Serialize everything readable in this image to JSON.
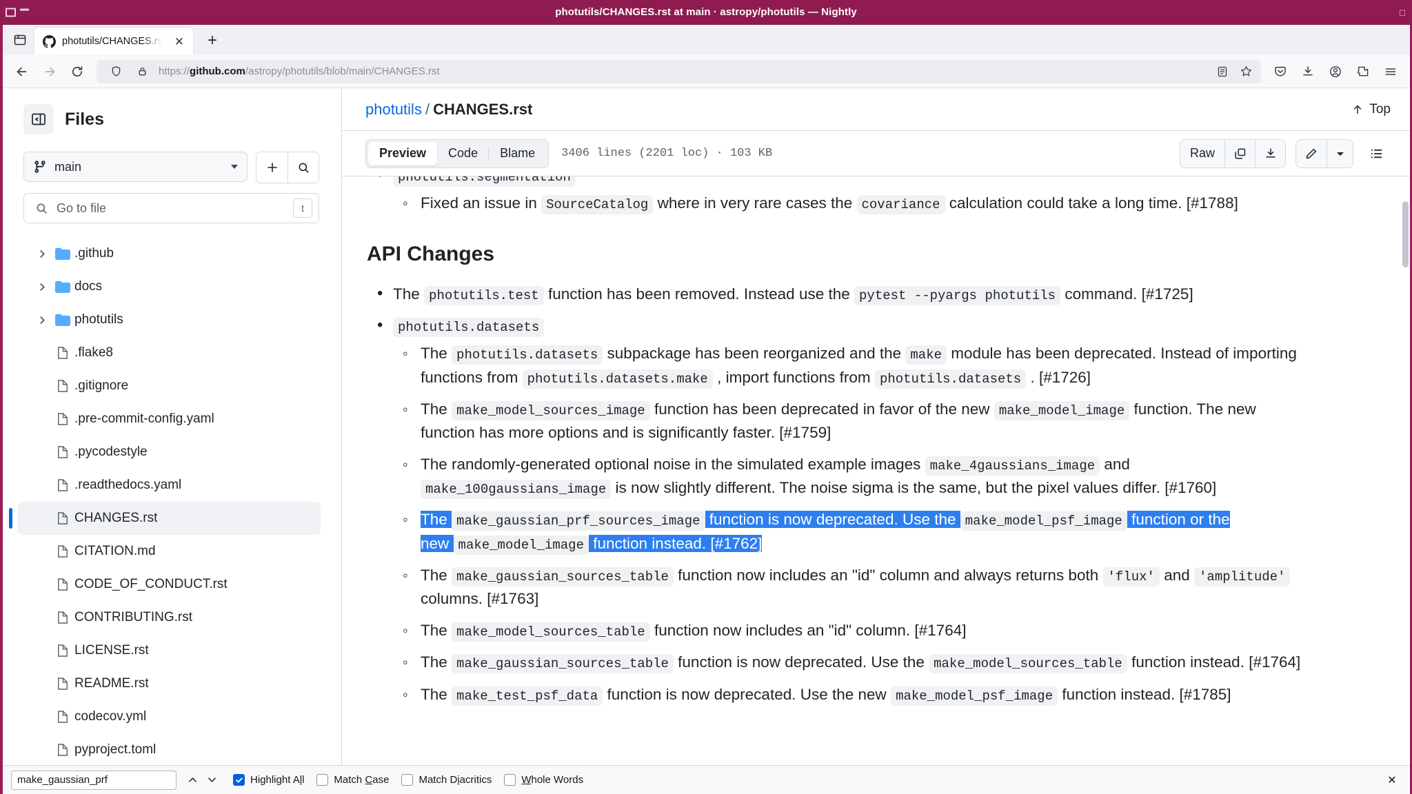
{
  "window": {
    "title": "photutils/CHANGES.rst at main · astropy/photutils — Nightly"
  },
  "browser": {
    "tab": {
      "title": "photutils/CHANGES.rst at",
      "close_label": "✕"
    },
    "newtab_label": "+",
    "url": {
      "prefix": "https://",
      "host": "github.com",
      "path": "/astropy/photutils/blob/main/CHANGES.rst"
    },
    "icons": {
      "back": "back-arrow",
      "forward": "forward-arrow",
      "reload": "reload",
      "shield": "shield",
      "lock": "padlock",
      "reader": "reader-mode",
      "bookmark": "star",
      "pocket": "save-to-pocket",
      "downloads": "downloads",
      "account": "account",
      "extensions": "extensions",
      "menu": "hamburger-menu",
      "list_all_tabs": "list-all-tabs"
    }
  },
  "sidebar": {
    "title": "Files",
    "branch": "main",
    "search_placeholder": "Go to file",
    "search_kbd": "t",
    "add_label": "+",
    "folders": [
      {
        "name": ".github"
      },
      {
        "name": "docs"
      },
      {
        "name": "photutils"
      }
    ],
    "files": [
      {
        "name": ".flake8",
        "active": false
      },
      {
        "name": ".gitignore",
        "active": false
      },
      {
        "name": ".pre-commit-config.yaml",
        "active": false
      },
      {
        "name": ".pycodestyle",
        "active": false
      },
      {
        "name": ".readthedocs.yaml",
        "active": false
      },
      {
        "name": "CHANGES.rst",
        "active": true
      },
      {
        "name": "CITATION.md",
        "active": false
      },
      {
        "name": "CODE_OF_CONDUCT.rst",
        "active": false
      },
      {
        "name": "CONTRIBUTING.rst",
        "active": false
      },
      {
        "name": "LICENSE.rst",
        "active": false
      },
      {
        "name": "README.rst",
        "active": false
      },
      {
        "name": "codecov.yml",
        "active": false
      },
      {
        "name": "pyproject.toml",
        "active": false
      }
    ]
  },
  "content": {
    "breadcrumb": {
      "repo": "photutils",
      "separator": "/",
      "file": "CHANGES.rst"
    },
    "top_button": "Top",
    "tabs": [
      {
        "label": "Preview",
        "active": true
      },
      {
        "label": "Code",
        "active": false
      },
      {
        "label": "Blame",
        "active": false
      }
    ],
    "file_stats": "3406 lines (2201 loc) · 103 KB",
    "actions": {
      "raw": "Raw",
      "copy": "copy-icon",
      "download": "download-icon",
      "edit": "pencil-icon",
      "more": "chevron-down-icon",
      "outline": "outline-icon"
    }
  },
  "document": {
    "partial_top": {
      "module": "photutils.segmentation",
      "item_a": "Fixed an issue in",
      "code_a": "SourceCatalog",
      "item_b": "where in very rare cases the",
      "code_b": "covariance",
      "item_c": "calculation could take a long time.",
      "ref": "[#1788]"
    },
    "heading": "API Changes",
    "b1": {
      "t1": "The",
      "c1": "photutils.test",
      "t2": "function has been removed. Instead use the",
      "c2": "pytest --pyargs photutils",
      "t3": "command. [#1725]"
    },
    "b2": {
      "code": "photutils.datasets",
      "sub1": {
        "t1": "The",
        "c1": "photutils.datasets",
        "t2": "subpackage has been reorganized and the",
        "c2": "make",
        "t3": "module has been deprecated. Instead of importing functions from",
        "c3": "photutils.datasets.make",
        "t4": ", import functions from",
        "c4": "photutils.datasets",
        "t5": ". [#1726]"
      },
      "sub2": {
        "t1": "The",
        "c1": "make_model_sources_image",
        "t2": "function has been deprecated in favor of the new",
        "c2": "make_model_image",
        "t3": "function. The new function has more options and is significantly faster. [#1759]"
      },
      "sub3": {
        "t1": "The randomly-generated optional noise in the simulated example images",
        "c1": "make_4gaussians_image",
        "t2": "and",
        "c2": "make_100gaussians_image",
        "t3": "is now slightly different. The noise sigma is the same, but the pixel values differ. [#1760]"
      },
      "sub4": {
        "highlighted": true,
        "t1": "The",
        "c1": "make_gaussian_prf_sources_image",
        "t2": "function is now deprecated. Use the",
        "c2": "make_model_psf_image",
        "t3": "function or the new",
        "c3": "make_model_image",
        "t4": "function instead. [#1762]"
      },
      "sub5": {
        "t1": "The",
        "c1": "make_gaussian_sources_table",
        "t2": "function now includes an \"id\" column and always returns both",
        "c2": "'flux'",
        "t3": "and",
        "c3": "'amplitude'",
        "t4": "columns. [#1763]"
      },
      "sub6": {
        "t1": "The",
        "c1": "make_model_sources_table",
        "t2": "function now includes an \"id\" column. [#1764]"
      },
      "sub7": {
        "t1": "The",
        "c1": "make_gaussian_sources_table",
        "t2": "function is now deprecated. Use the",
        "c2": "make_model_sources_table",
        "t3": "function instead. [#1764]"
      },
      "sub8": {
        "t1": "The",
        "c1": "make_test_psf_data",
        "t2": "function is now deprecated. Use the new",
        "c2": "make_model_psf_image",
        "t3": "function instead. [#1785]"
      }
    }
  },
  "findbar": {
    "query": "make_gaussian_prf",
    "prev_label": "∧",
    "next_label": "∨",
    "options": [
      {
        "label_pre": "Highlight A",
        "label_accel": "l",
        "label_post": "l",
        "checked": true
      },
      {
        "label_pre": "Match ",
        "label_accel": "C",
        "label_post": "ase",
        "checked": false
      },
      {
        "label_pre": "Match D",
        "label_accel": "i",
        "label_post": "acritics",
        "checked": false
      },
      {
        "label_pre": "",
        "label_accel": "W",
        "label_post": "hole Words",
        "checked": false
      }
    ],
    "close_label": "✕"
  },
  "colors": {
    "titlebar": "#8f1b50",
    "accent_link": "#0969da",
    "selection": "#2d7ff0",
    "folder": "#54aeff"
  }
}
